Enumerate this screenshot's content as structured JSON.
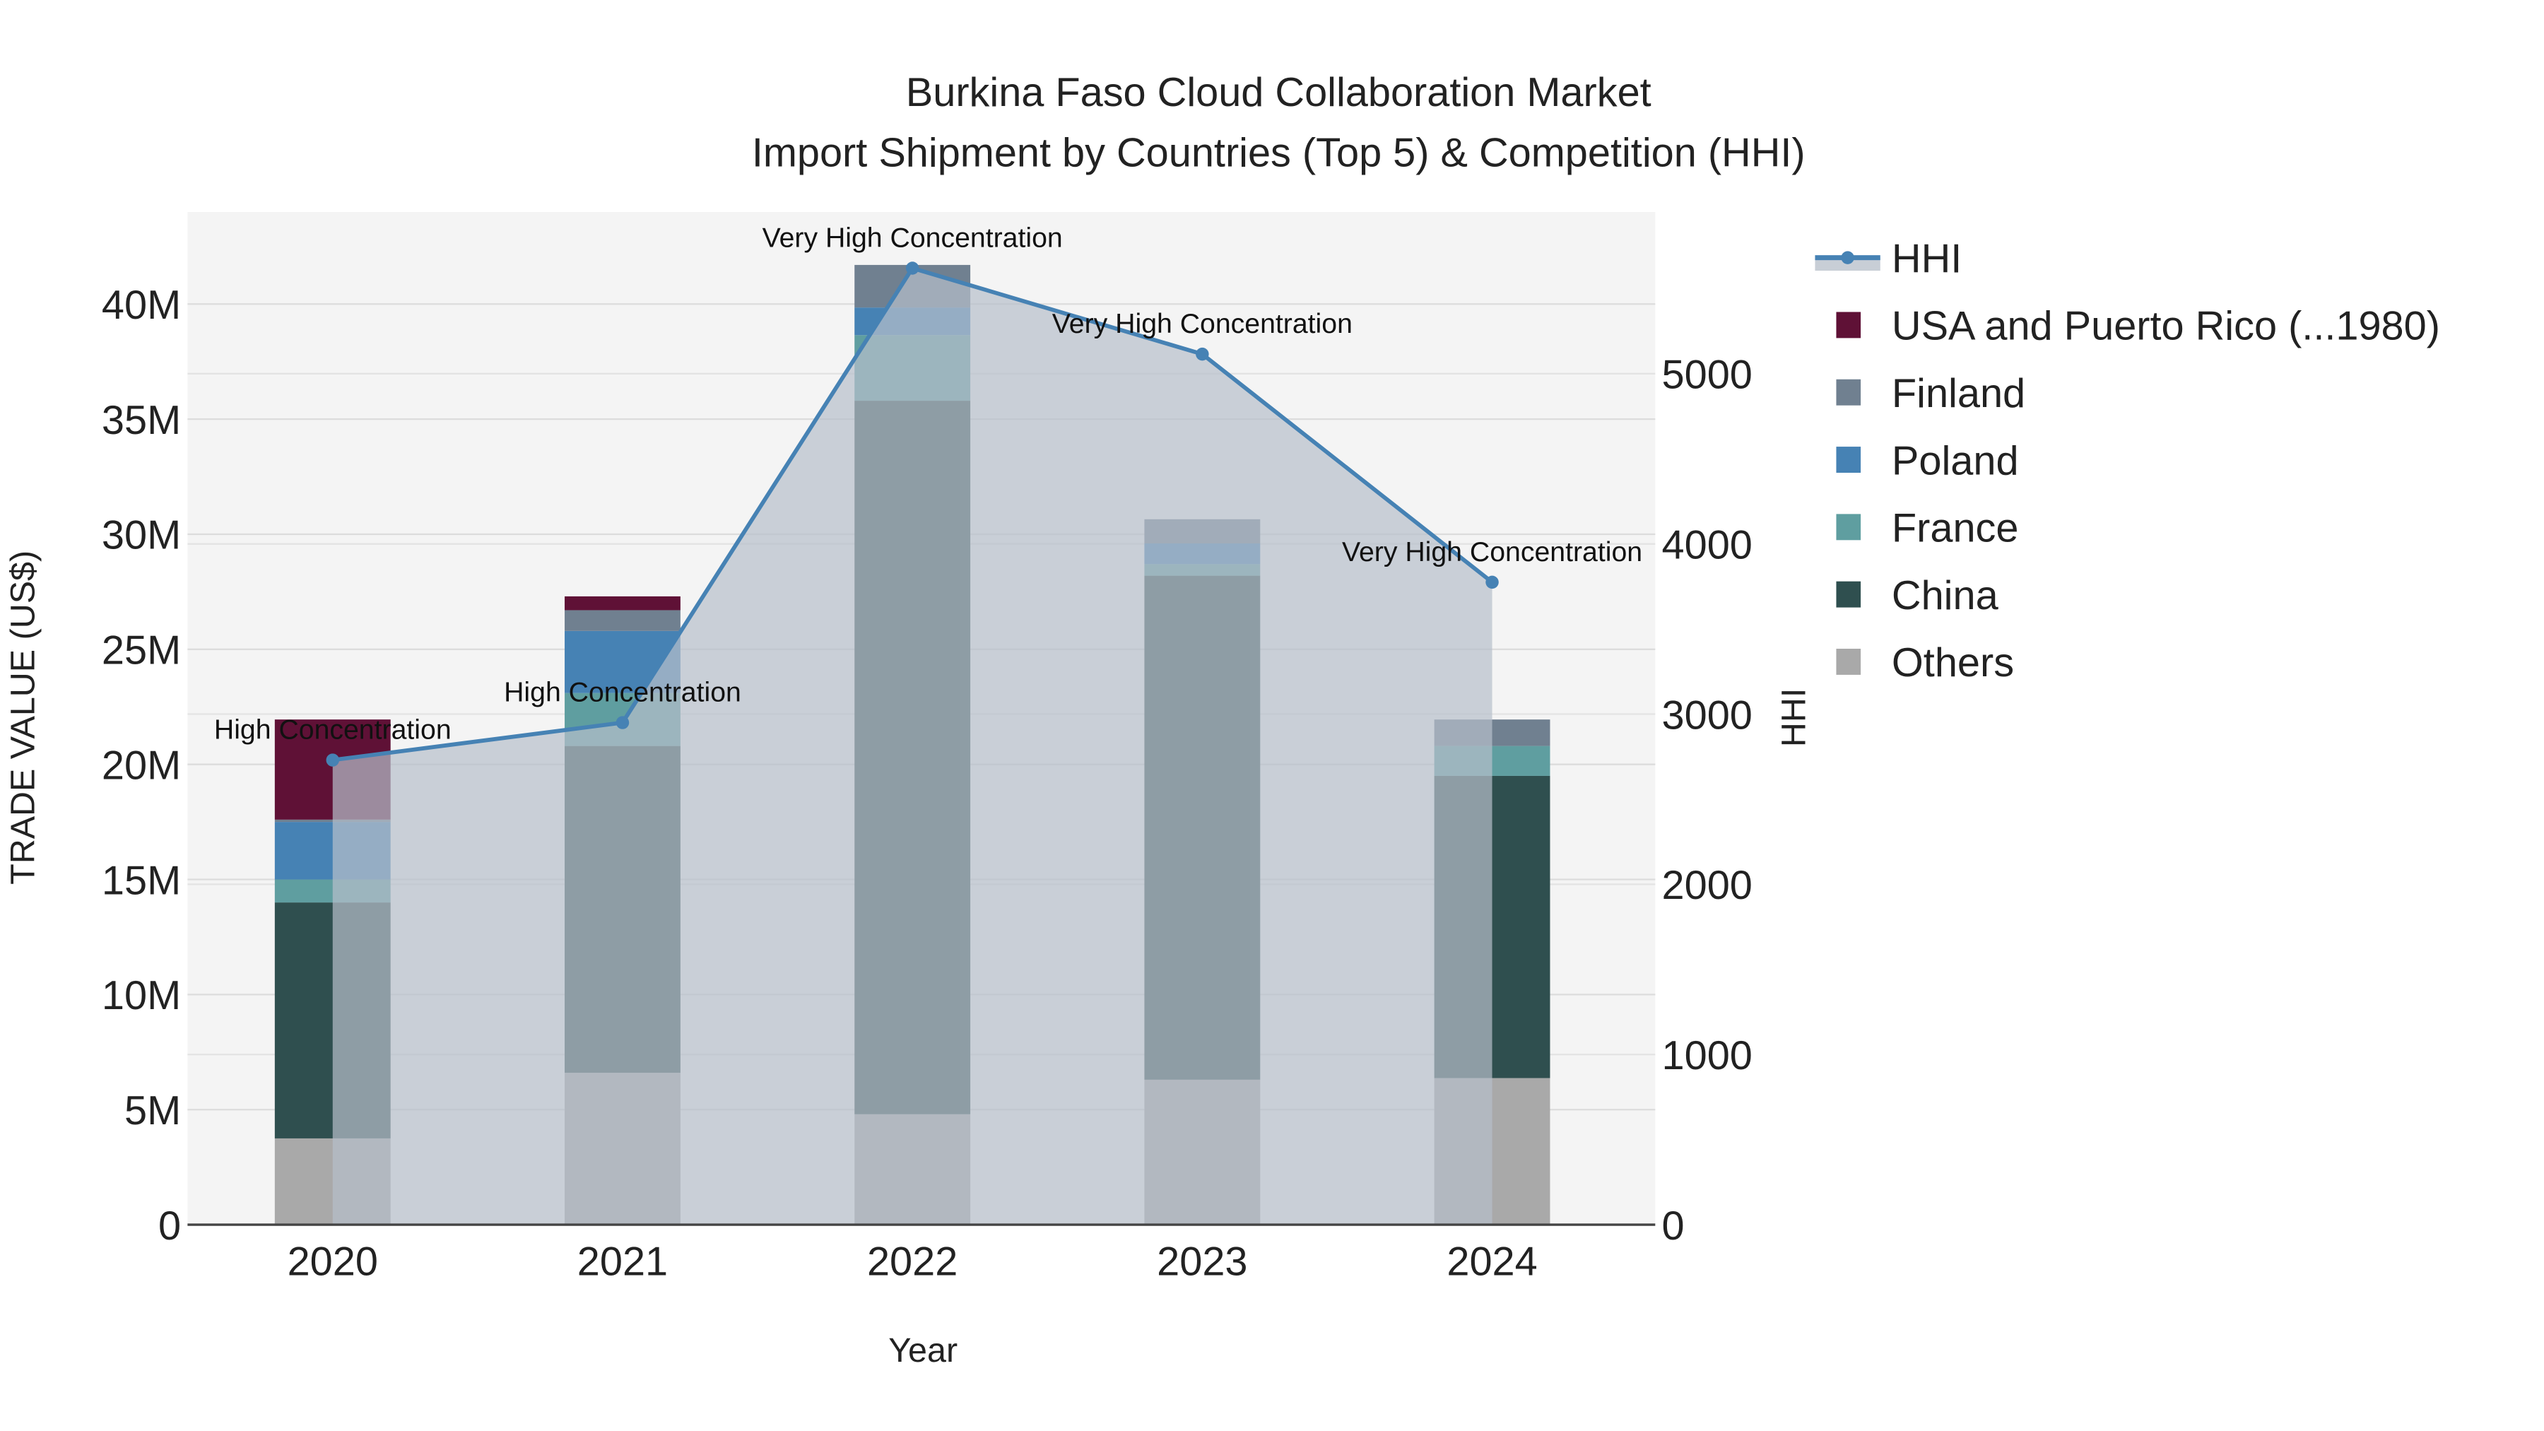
{
  "chart_data": {
    "type": "bar",
    "title": "Burkina Faso Cloud Collaboration Market",
    "subtitle": "Import Shipment by Countries (Top 5) & Competition (HHI)",
    "xlabel": "Year",
    "ylabel": "TRADE VALUE (US$)",
    "y2label": "HHI",
    "categories": [
      "2020",
      "2021",
      "2022",
      "2023",
      "2024"
    ],
    "ylim": [
      0,
      44000000
    ],
    "y2lim": [
      0,
      5950
    ],
    "yticks": [
      0,
      5000000,
      10000000,
      15000000,
      20000000,
      25000000,
      30000000,
      35000000,
      40000000
    ],
    "ytick_labels": [
      "0",
      "5M",
      "10M",
      "15M",
      "20M",
      "25M",
      "30M",
      "35M",
      "40M"
    ],
    "y2ticks": [
      0,
      1000,
      2000,
      3000,
      4000,
      5000
    ],
    "y2tick_labels": [
      "0",
      "1000",
      "2000",
      "3000",
      "4000",
      "5000"
    ],
    "grid": true,
    "stacked": true,
    "legend_position": "right",
    "series": [
      {
        "name": "Others",
        "color": "#a9a9a9",
        "values": [
          3750000,
          6600000,
          4800000,
          6300000,
          6370000
        ]
      },
      {
        "name": "China",
        "color": "#2f4f4f",
        "values": [
          10250000,
          14200000,
          31000000,
          21900000,
          13130000
        ]
      },
      {
        "name": "France",
        "color": "#5f9ea0",
        "values": [
          1000000,
          2300000,
          2850000,
          500000,
          1300000
        ]
      },
      {
        "name": "Poland",
        "color": "#4682b4",
        "values": [
          2500000,
          2700000,
          1200000,
          900000,
          0
        ]
      },
      {
        "name": "Finland",
        "color": "#708090",
        "values": [
          100000,
          900000,
          1850000,
          1050000,
          1150000
        ]
      },
      {
        "name": "USA and Puerto Rico (...1980)",
        "color": "#5f1136",
        "values": [
          4350000,
          600000,
          0,
          0,
          0
        ]
      }
    ],
    "hhi": {
      "name": "HHI",
      "color": "#4682b4",
      "values": [
        2730,
        2950,
        5620,
        5115,
        3775
      ],
      "annotations": [
        "High Concentration",
        "High Concentration",
        "Very High Concentration",
        "Very High Concentration",
        "Very High Concentration"
      ]
    },
    "legend_order": [
      "HHI",
      "USA and Puerto Rico (...1980)",
      "Finland",
      "Poland",
      "France",
      "China",
      "Others"
    ]
  }
}
